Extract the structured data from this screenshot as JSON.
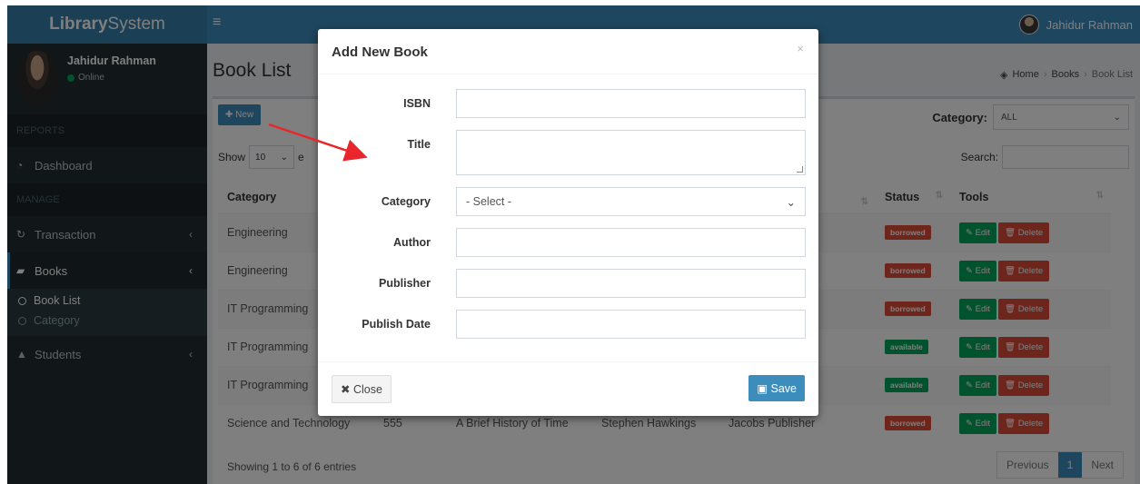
{
  "brand": {
    "bold": "Library",
    "light": "System"
  },
  "top_user": {
    "name": "Jahidur Rahman"
  },
  "sidebar": {
    "user": {
      "name": "Jahidur Rahman",
      "status": "Online"
    },
    "headers": [
      "REPORTS",
      "MANAGE"
    ],
    "items": [
      {
        "label": "Dashboard",
        "icon": "dashboard-icon"
      },
      {
        "label": "Transaction",
        "icon": "refresh-icon"
      },
      {
        "label": "Books",
        "icon": "book-icon"
      },
      {
        "label": "Students",
        "icon": "graduation-cap-icon"
      }
    ],
    "submenu": [
      "Book List",
      "Category"
    ]
  },
  "page": {
    "title": "Book List",
    "breadcrumb": [
      "Home",
      "Books",
      "Book List"
    ],
    "new_button": "New",
    "category_label": "Category:",
    "category_value": "ALL",
    "show_label": "Show",
    "show_value": "10",
    "show_suffix": "e",
    "search_label": "Search:",
    "showing": "Showing 1 to 6 of 6 entries",
    "pager": {
      "prev": "Previous",
      "current": "1",
      "next": "Next"
    }
  },
  "table": {
    "headers": {
      "category": "Category",
      "status": "Status",
      "tools": "Tools"
    },
    "rows": [
      {
        "category": "Engineering",
        "c5": "r",
        "status": "borrowed"
      },
      {
        "category": "Engineering",
        "c5": "r",
        "status": "borrowed"
      },
      {
        "category": "IT Programming",
        "c5": "ishers",
        "status": "borrowed"
      },
      {
        "category": "IT Programming",
        "c5": "r",
        "status": "available"
      },
      {
        "category": "IT Programming",
        "c5": "r",
        "status": "available"
      },
      {
        "category": "Science and Technology",
        "isbn": "555",
        "title": "A Brief History of Time",
        "author": "Stephen Hawkings",
        "c5": "Jacobs Publisher",
        "status": "borrowed"
      }
    ],
    "edit_label": "Edit",
    "delete_label": "Delete"
  },
  "modal": {
    "title": "Add New Book",
    "close_x": "×",
    "fields": {
      "isbn": "ISBN",
      "title": "Title",
      "category": "Category",
      "category_placeholder": "- Select -",
      "author": "Author",
      "publisher": "Publisher",
      "publish_date": "Publish Date"
    },
    "close_button": "Close",
    "save_button": "Save"
  },
  "colors": {
    "primary": "#3c8dbc",
    "danger": "#dd4b39",
    "success": "#00a65a",
    "sidebar": "#222d32",
    "annotation_arrow": "#e8262b"
  }
}
